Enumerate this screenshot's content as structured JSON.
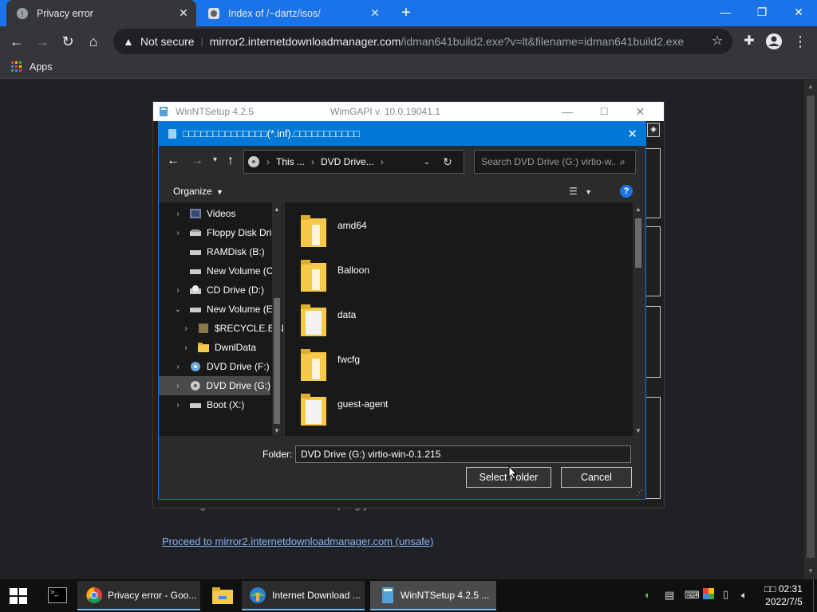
{
  "tabs": [
    {
      "title": "Privacy error",
      "active": true
    },
    {
      "title": "Index of /~dartz/isos/",
      "active": false
    }
  ],
  "new_tab_symbol": "+",
  "omnibox": {
    "security_label": "Not secure",
    "url_host": "mirror2.internetdownloadmanager.com",
    "url_rest": "/idman641build2.exe?v=lt&filename=idman641build2.exe"
  },
  "bookmarks": {
    "apps_label": "Apps"
  },
  "page": {
    "partial_text": "misconfiguration or an attacker intercepting your connection.",
    "proceed_link": "Proceed to mirror2.internetdownloadmanager.com (unsafe)"
  },
  "winntsetup": {
    "title": "WinNTSetup 4.2.5",
    "subtitle": "WimGAPI v. 10.0.19041.1"
  },
  "dialog": {
    "title": "□□□□□□□□□□□□□□(*.inf).□□□□□□□□□□□",
    "breadcrumb": [
      "This ...",
      "DVD Drive..."
    ],
    "search_placeholder": "Search DVD Drive (G:) virtio-w...",
    "organize_label": "Organize",
    "tree": [
      {
        "label": "Videos",
        "expanded": false,
        "indent": 0,
        "icon": "videos-icon"
      },
      {
        "label": "Floppy Disk Dri",
        "expanded": false,
        "indent": 0,
        "icon": "drive-icon"
      },
      {
        "label": "RAMDisk (B:)",
        "expanded": false,
        "indent": 0,
        "icon": "drive-icon"
      },
      {
        "label": "New Volume (C",
        "expanded": false,
        "indent": 0,
        "icon": "drive-icon"
      },
      {
        "label": "CD Drive (D:)",
        "expanded": false,
        "indent": 0,
        "icon": "cd-drive-icon"
      },
      {
        "label": "New Volume (E",
        "expanded": true,
        "indent": 0,
        "icon": "drive-icon"
      },
      {
        "label": "$RECYCLE.BIN",
        "expanded": false,
        "indent": 1,
        "icon": "recycle-folder-icon"
      },
      {
        "label": "DwnlData",
        "expanded": false,
        "indent": 1,
        "icon": "folder-icon"
      },
      {
        "label": "DVD Drive (F:) I",
        "expanded": false,
        "indent": 0,
        "icon": "dvd-drive-icon"
      },
      {
        "label": "DVD Drive (G:)",
        "expanded": false,
        "indent": 0,
        "icon": "dvd-drive-icon",
        "selected": true
      },
      {
        "label": "Boot (X:)",
        "expanded": false,
        "indent": 0,
        "icon": "drive-icon"
      }
    ],
    "folders": [
      "amd64",
      "Balloon",
      "data",
      "fwcfg",
      "guest-agent"
    ],
    "folder_label": "Folder:",
    "folder_value": "DVD Drive (G:) virtio-win-0.1.215",
    "select_button": "Select Folder",
    "cancel_button": "Cancel"
  },
  "taskbar": {
    "items": [
      {
        "label": "Privacy error - Goo...",
        "state": "open"
      },
      {
        "label": "Internet Download ...",
        "state": "open"
      },
      {
        "label": "WinNTSetup 4.2.5   ...",
        "state": "active"
      }
    ],
    "clock_time": "□□ 02:31",
    "clock_date": "2022/7/5"
  },
  "colors": {
    "accent": "#1a73e8",
    "dialog_title": "#0078d7",
    "link": "#8ab4f8"
  }
}
